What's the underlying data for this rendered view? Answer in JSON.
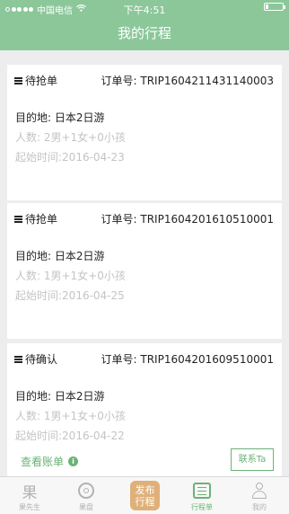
{
  "status_bar": {
    "carrier": "中国电信",
    "time": "下午4:51",
    "battery_level": 0.15
  },
  "nav": {
    "title": "我的行程"
  },
  "trips": [
    {
      "status": "待抢单",
      "order": "订单号: TRIP1604211431140003",
      "destination": "目的地: 日本2日游",
      "people": "人数: 2男+1女+0小孩",
      "start_date": "起始时间:2016-04-23"
    },
    {
      "status": "待抢单",
      "order": "订单号: TRIP1604201610510001",
      "destination": "目的地: 日本2日游",
      "people": "人数: 1男+1女+0小孩",
      "start_date": "起始时间:2016-04-25"
    },
    {
      "status": "待确认",
      "order": "订单号: TRIP1604201609510001",
      "destination": "目的地: 日本2日游",
      "people": "人数: 1男+1女+0小孩",
      "start_date": "起始时间:2016-04-22",
      "view_bill": "查看账单",
      "contact": "联系Ta"
    }
  ],
  "tabs": [
    {
      "label": "果先生",
      "glyph": "果",
      "icon": "fruit-icon"
    },
    {
      "label": "果盘",
      "icon": "plate-icon"
    },
    {
      "label": "发布行程",
      "icon": "publish-icon"
    },
    {
      "label": "行程单",
      "icon": "list-icon"
    },
    {
      "label": "我的",
      "icon": "person-icon"
    }
  ],
  "colors": {
    "accent": "#8cc79a",
    "link": "#6cb277",
    "publish": "#dfb079"
  }
}
